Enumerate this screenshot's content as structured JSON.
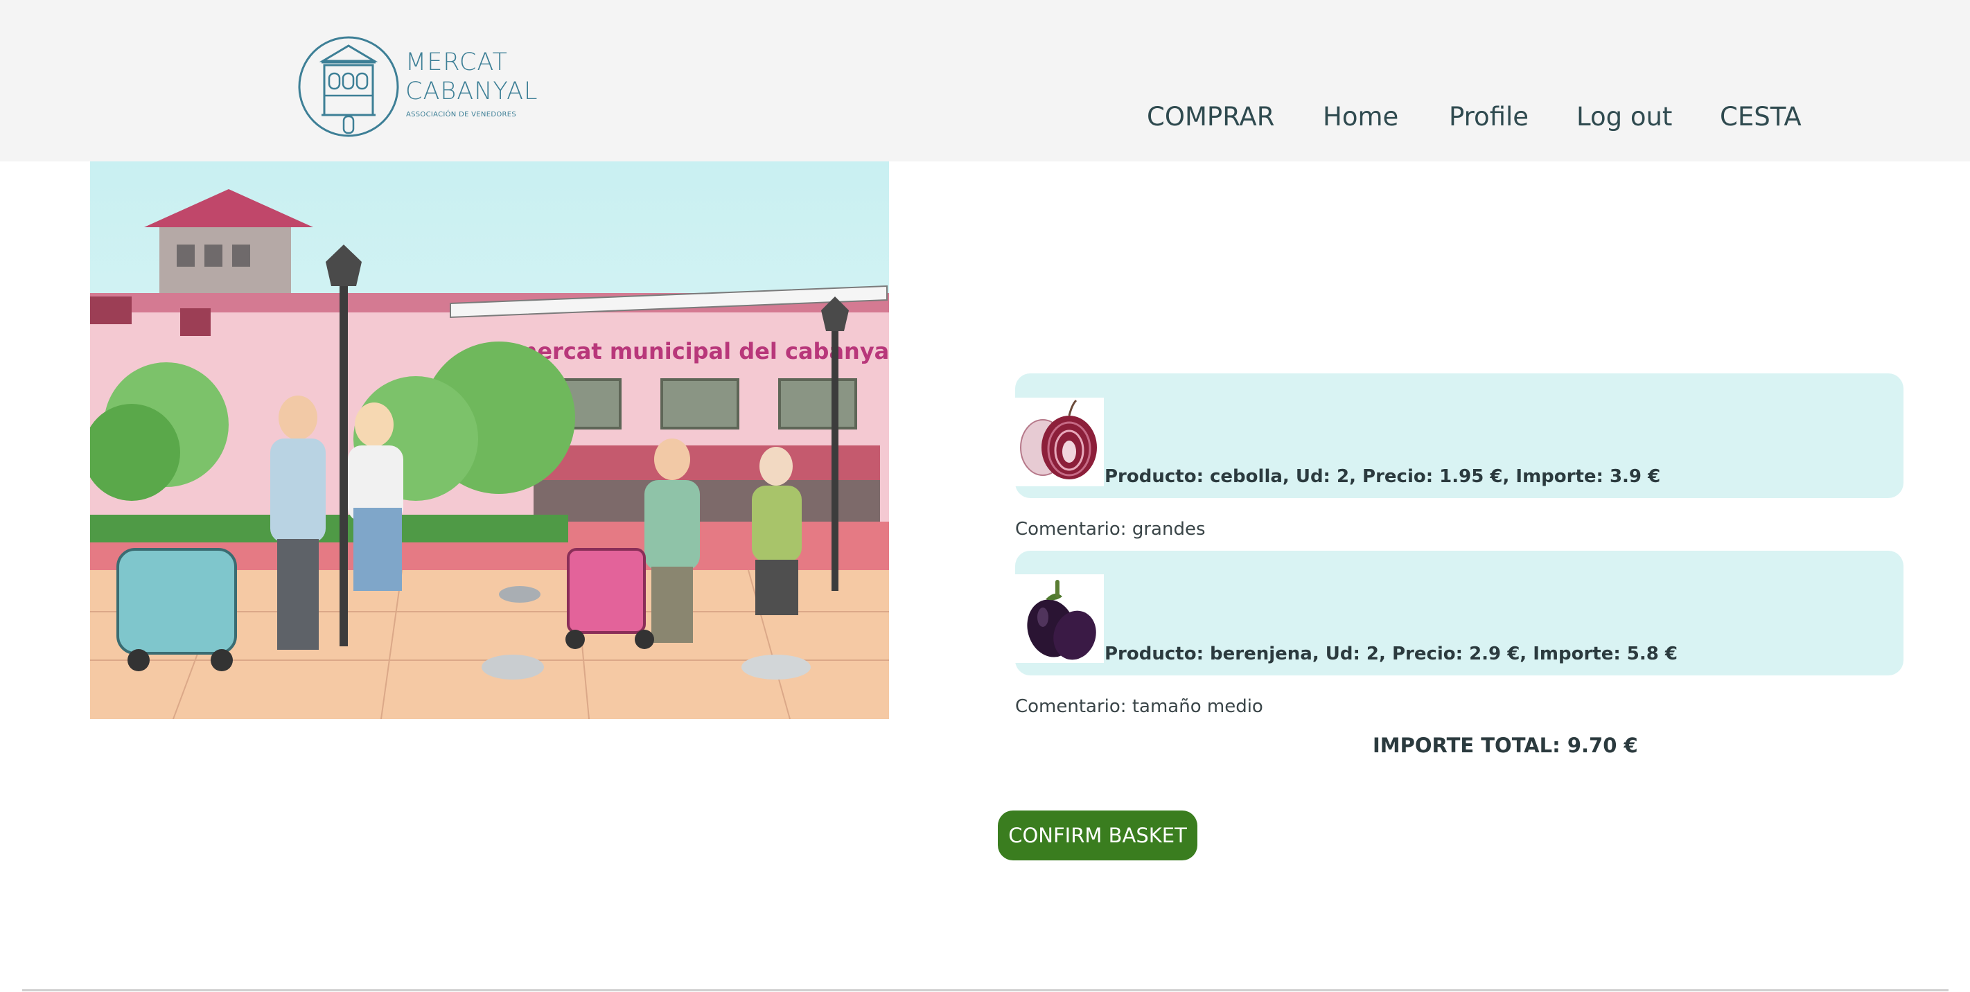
{
  "header": {
    "logo": {
      "line1": "MERCAT",
      "line2": "CABANYAL",
      "subtitle": "ASSOCIACIÓN DE VENEDORES"
    },
    "nav": [
      {
        "label": "COMPRAR"
      },
      {
        "label": "Home"
      },
      {
        "label": "Profile"
      },
      {
        "label": "Log out"
      },
      {
        "label": "CESTA"
      }
    ]
  },
  "hero": {
    "banner_text": "mercat municipal del cabanyal"
  },
  "basket": {
    "items": [
      {
        "text": "Producto: cebolla, Ud: 2, Precio: 1.95 €, Importe: 3.9 €",
        "comment": "Comentario: grandes",
        "icon": "onion-image"
      },
      {
        "text": "Producto: berenjena, Ud: 2, Precio: 2.9 €, Importe: 5.8 €",
        "comment": "Comentario: tamaño medio",
        "icon": "eggplant-image"
      }
    ],
    "total": "IMPORTE TOTAL: 9.70 €",
    "confirm_label": "CONFIRM BASKET"
  },
  "colors": {
    "header_bg": "#f4f4f4",
    "card_bg": "#d9f3f3",
    "button_bg": "#3a7d1f",
    "logo": "#3d7f96"
  }
}
